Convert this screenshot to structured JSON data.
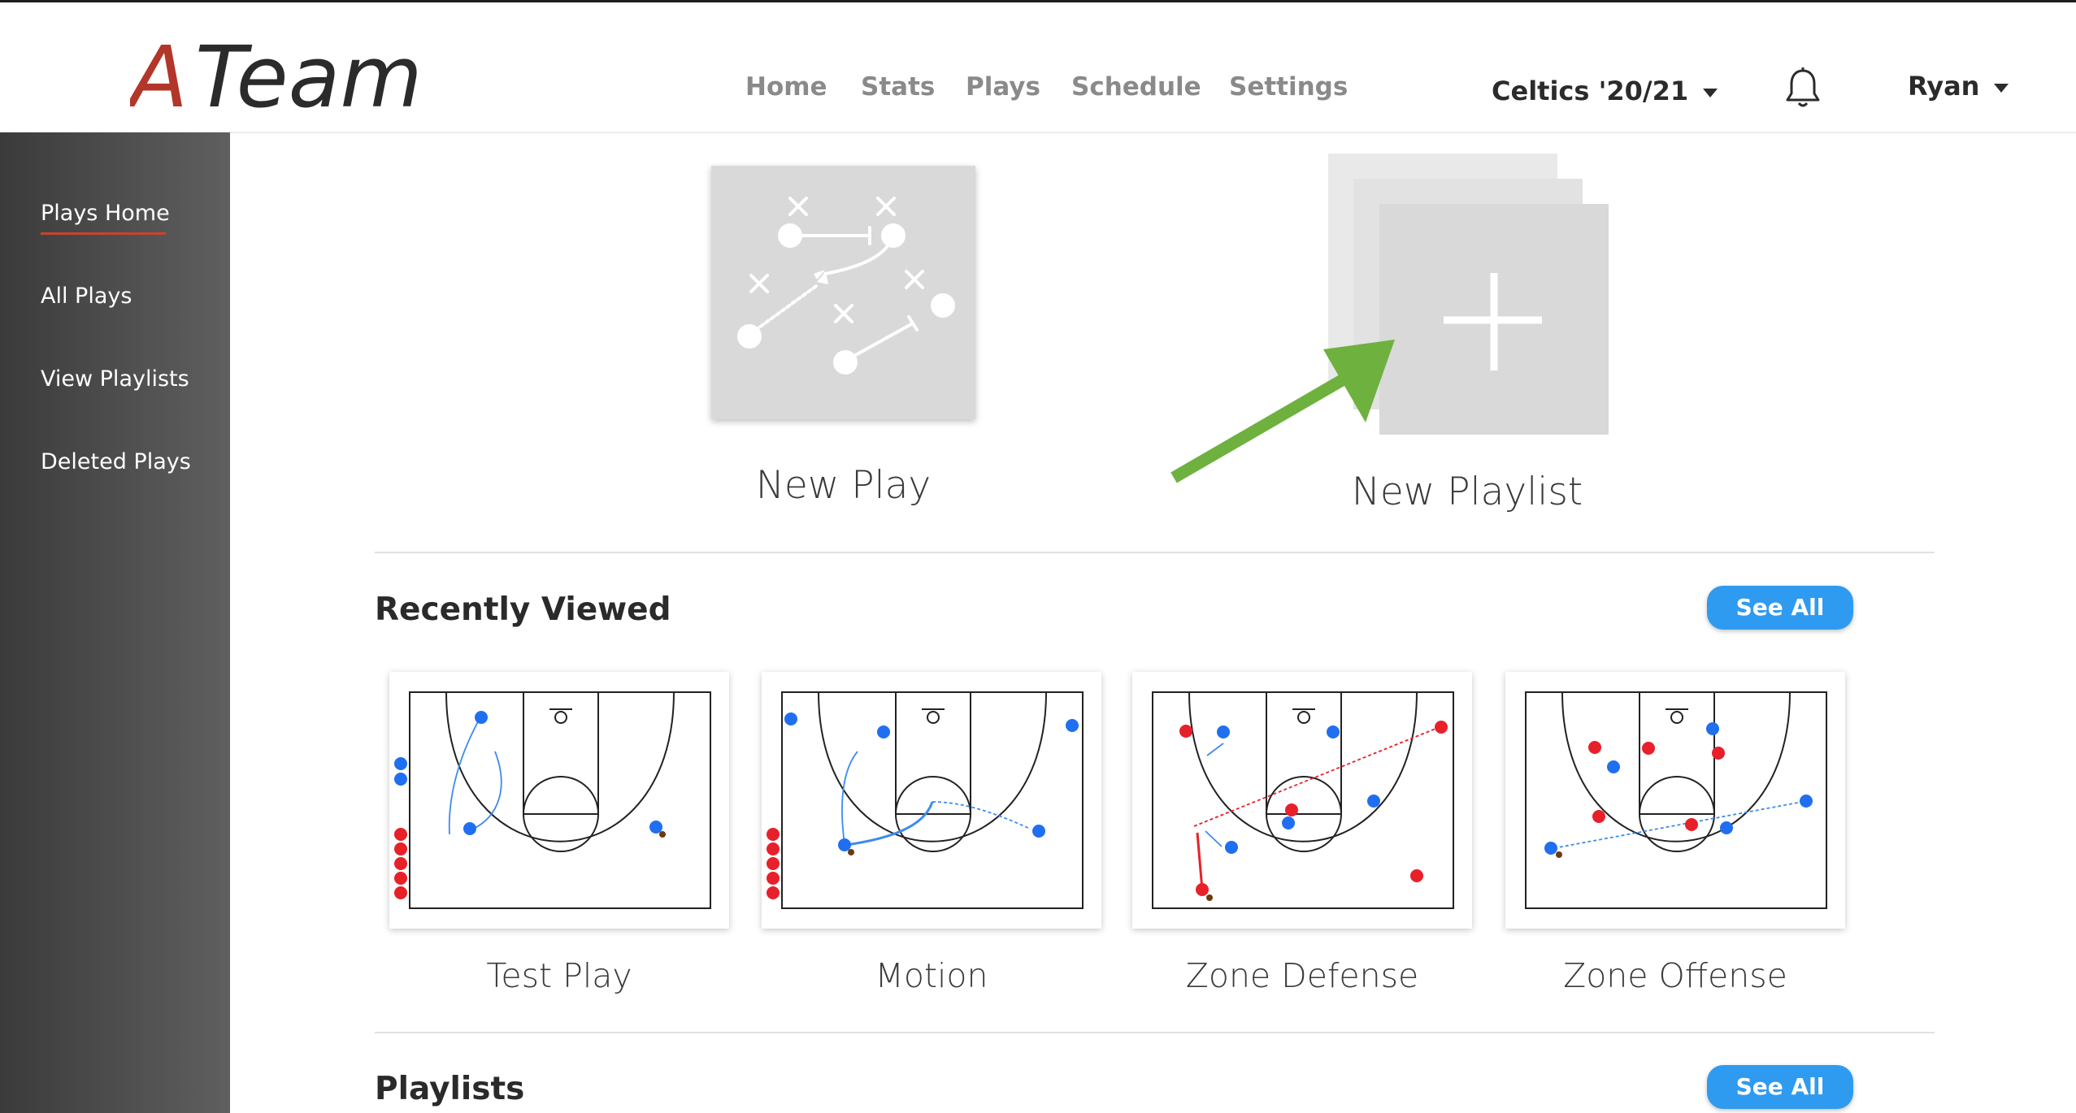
{
  "app": {
    "logo_text": "ATeam",
    "brand_color": "#b2362a",
    "accent_color": "#2e9bf0",
    "arrow_color": "#6fb13f"
  },
  "nav": {
    "items": [
      "Home",
      "Stats",
      "Plays",
      "Schedule",
      "Settings"
    ]
  },
  "team_selector": {
    "label": "Celtics '20/21",
    "icon": "caret-down-icon"
  },
  "notifications": {
    "icon": "bell-icon"
  },
  "user": {
    "name": "Ryan",
    "icon": "caret-down-icon"
  },
  "sidebar": {
    "items": [
      {
        "label": "Plays Home",
        "active": true
      },
      {
        "label": "All Plays",
        "active": false
      },
      {
        "label": "View Playlists",
        "active": false
      },
      {
        "label": "Deleted Plays",
        "active": false
      }
    ]
  },
  "actions": {
    "new_play": {
      "label": "New Play",
      "icon": "play-diagram-icon"
    },
    "new_playlist": {
      "label": "New Playlist",
      "icon": "plus-icon"
    }
  },
  "recently_viewed": {
    "title": "Recently Viewed",
    "see_all": "See All",
    "plays": [
      {
        "name": "Test Play"
      },
      {
        "name": "Motion"
      },
      {
        "name": "Zone Defense"
      },
      {
        "name": "Zone Offense"
      }
    ]
  },
  "playlists": {
    "title": "Playlists",
    "see_all": "See All"
  }
}
